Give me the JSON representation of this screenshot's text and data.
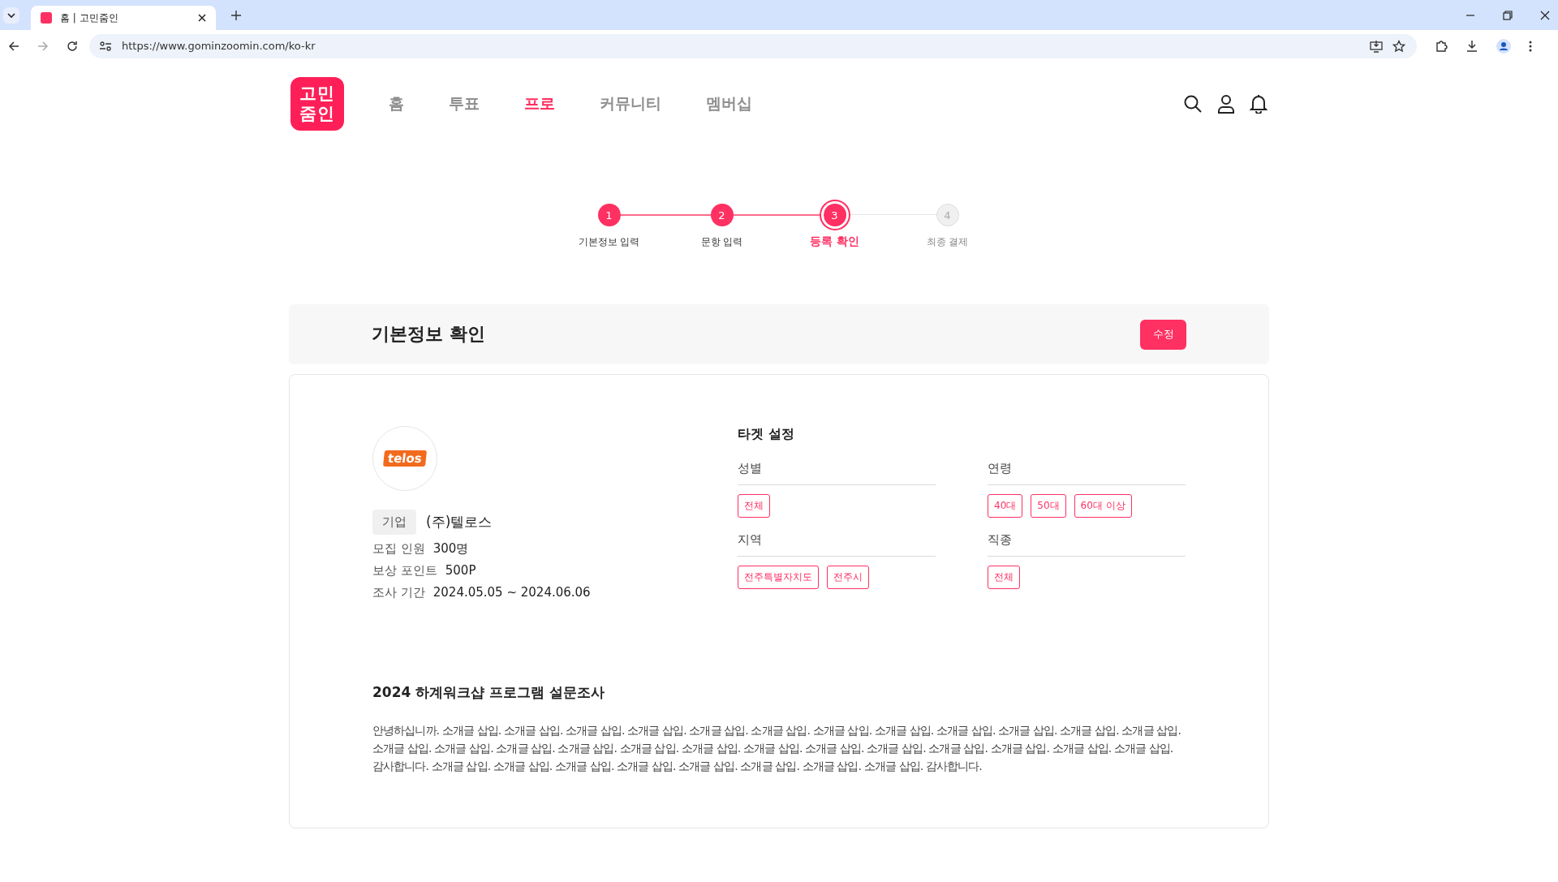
{
  "browser": {
    "tab_title": "홈 | 고민줌인",
    "url": "https://www.gominzoomin.com/ko-kr"
  },
  "header": {
    "logo_text": "고민줌인",
    "nav": [
      {
        "label": "홈",
        "selected": false
      },
      {
        "label": "투표",
        "selected": false
      },
      {
        "label": "프로",
        "selected": true
      },
      {
        "label": "커뮤니티",
        "selected": false
      },
      {
        "label": "멤버십",
        "selected": false
      }
    ]
  },
  "steps": [
    {
      "number": "1",
      "label": "기본정보 입력",
      "completed": true,
      "selected": false
    },
    {
      "number": "2",
      "label": "문항 입력",
      "completed": true,
      "selected": false
    },
    {
      "number": "3",
      "label": "등록 확인",
      "completed": false,
      "selected": true
    },
    {
      "number": "4",
      "label": "최종 결제",
      "completed": false,
      "selected": false
    }
  ],
  "section": {
    "title": "기본정보 확인",
    "edit_button": "수정"
  },
  "company": {
    "logo_text": "telos",
    "type_tag": "기업",
    "name": "(주)텔로스",
    "info": [
      {
        "label": "모집 인원",
        "value": "300명"
      },
      {
        "label": "보상 포인트",
        "value": "500P"
      },
      {
        "label": "조사 기간",
        "value": "2024.05.05 ~ 2024.06.06"
      }
    ]
  },
  "target": {
    "title": "타겟 설정",
    "groups": [
      {
        "label": "성별",
        "chips": [
          "전체"
        ]
      },
      {
        "label": "연령",
        "chips": [
          "40대",
          "50대",
          "60대 이상"
        ]
      },
      {
        "label": "지역",
        "chips": [
          "전주특별자치도",
          "전주시"
        ]
      },
      {
        "label": "직종",
        "chips": [
          "전체"
        ]
      }
    ]
  },
  "survey": {
    "title": "2024 하계워크샵 프로그램 설문조사",
    "description": "안녕하십니까. 소개글 삽입. 소개글 삽입. 소개글 삽입. 소개글 삽입. 소개글 삽입. 소개글 삽입. 소개글 삽입. 소개글 삽입. 소개글 삽입. 소개글 삽입. 소개글 삽입. 소개글 삽입. 소개글 삽입. 소개글 삽입. 소개글 삽입. 소개글 삽입. 소개글 삽입. 소개글 삽입. 소개글 삽입. 소개글 삽입. 소개글 삽입. 소개글 삽입. 소개글 삽입. 소개글 삽입. 소개글 삽입. 감사합니다. 소개글 삽입. 소개글 삽입. 소개글 삽입. 소개글 삽입. 소개글 삽입. 소개글 삽입. 소개글 삽입. 소개글 삽입. 감사합니다."
  }
}
